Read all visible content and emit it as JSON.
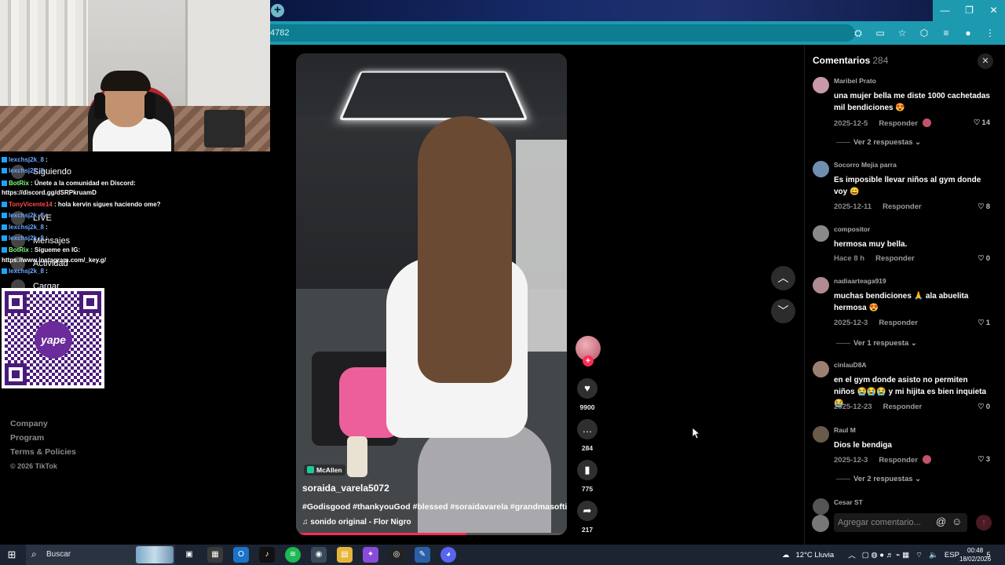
{
  "browser": {
    "address_text": "4782",
    "window_controls": {
      "minimize": "—",
      "maximize": "❐",
      "close": "✕"
    },
    "new_tab_label": "+"
  },
  "stream_overlay": {
    "chat": [
      {
        "user": "lexchsj2k_8",
        "message": " : ",
        "user_color": "#6aa7ff"
      },
      {
        "user": "lexchsj2k_8",
        "message": " : ",
        "user_color": "#6aa7ff"
      },
      {
        "user": "BotRix",
        "message": " : Únete a la comunidad en Discord:",
        "user_color": "#7fff7f"
      },
      {
        "user": "",
        "message": "https://discord.gg/dSRPkruamD",
        "user_color": "#ffffff"
      },
      {
        "user": "TonyVicente14",
        "message": " : hola kervin sigues haciendo ome?",
        "user_color": "#ff4b4b"
      },
      {
        "user": "lexchsj2k_8",
        "message": " : ",
        "user_color": "#6aa7ff"
      },
      {
        "user": "lexchsj2k_8",
        "message": " : ",
        "user_color": "#6aa7ff"
      },
      {
        "user": "lexchsj2k_8",
        "message": " : ",
        "user_color": "#6aa7ff"
      },
      {
        "user": "BotRix",
        "message": " : Sígueme en IG:",
        "user_color": "#7fff7f"
      },
      {
        "user": "",
        "message": "https://www.instagram.com/_key.g/",
        "user_color": "#ffffff"
      },
      {
        "user": "lexchsj2k_8",
        "message": " : ",
        "user_color": "#6aa7ff"
      }
    ],
    "qr_logo_text": "yape"
  },
  "tiktok_nav": {
    "items": [
      "Siguiendo",
      "LIVE",
      "Mensajes",
      "Actividad",
      "Cargar"
    ],
    "footer": [
      "Company",
      "Program",
      "Terms & Policies"
    ],
    "copyright": "© 2026 TikTok"
  },
  "video": {
    "location": "McAllen",
    "author": "soraida_varela5072",
    "caption": "#Godisgood #thankyouGod #blessed #soraidavarela #grandmasoftiktok",
    "sound": "sonido original - Flor Nigro",
    "progress": 0.63,
    "actions": {
      "likes": "9900",
      "comments": "284",
      "saves": "775",
      "shares": "217"
    },
    "follow_label": "+"
  },
  "comments_panel": {
    "title": "Comentarios",
    "count": "284",
    "reply_label": "Responder",
    "items": [
      {
        "user": "Maribel Prato",
        "text": "una mujer bella me diste 1000 cachetadas mil bendiciones 😍",
        "date": "2025-12-5",
        "likes": "14",
        "creator_liked": true,
        "more_replies": "Ver 2 respuestas",
        "avatar_color": "#c89aa8"
      },
      {
        "user": "Socorro Mejia parra",
        "text": "Es imposible llevar niños al gym donde voy 😀",
        "date": "2025-12-11",
        "likes": "8",
        "creator_liked": false,
        "more_replies": "",
        "avatar_color": "#6f8fb0"
      },
      {
        "user": "compositor",
        "text": "hermosa muy bella.",
        "date": "Hace 8 h",
        "likes": "0",
        "creator_liked": false,
        "more_replies": "",
        "avatar_color": "#8a8a8a"
      },
      {
        "user": "nadiaarteaga919",
        "text": "muchas bendiciones 🙏 ala abuelita hermosa 😍",
        "date": "2025-12-3",
        "likes": "1",
        "creator_liked": false,
        "more_replies": "Ver 1 respuesta",
        "avatar_color": "#b08a90"
      },
      {
        "user": "cinlauD8A",
        "text": "en el gym donde asisto no permiten niños 😭😭😭 y mi hijita es bien inquieta 😭",
        "date": "2025-12-23",
        "likes": "0",
        "creator_liked": false,
        "more_replies": "",
        "avatar_color": "#9c7f70"
      },
      {
        "user": "Raul M",
        "text": "Dios le bendiga",
        "date": "2025-12-3",
        "likes": "3",
        "creator_liked": true,
        "more_replies": "Ver 2 respuestas",
        "avatar_color": "#6a5a4a"
      },
      {
        "user": "Cesar ST",
        "text": "",
        "date": "",
        "likes": "",
        "creator_liked": false,
        "more_replies": "",
        "avatar_color": "#555555"
      }
    ],
    "input_placeholder": "Agregar comentario...",
    "at_symbol": "@",
    "emoji_symbol": "☺",
    "send_symbol": "↑"
  },
  "taskbar": {
    "search_label": "Buscar",
    "weather": "12°C  Lluvia",
    "language": "ESP",
    "time": "00:48",
    "date": "18/02/2026",
    "notification_count": "5"
  },
  "colors": {
    "accent": "#fe2c55",
    "browser_teal": "#1e9ab0",
    "panel_bg": "#000000"
  }
}
